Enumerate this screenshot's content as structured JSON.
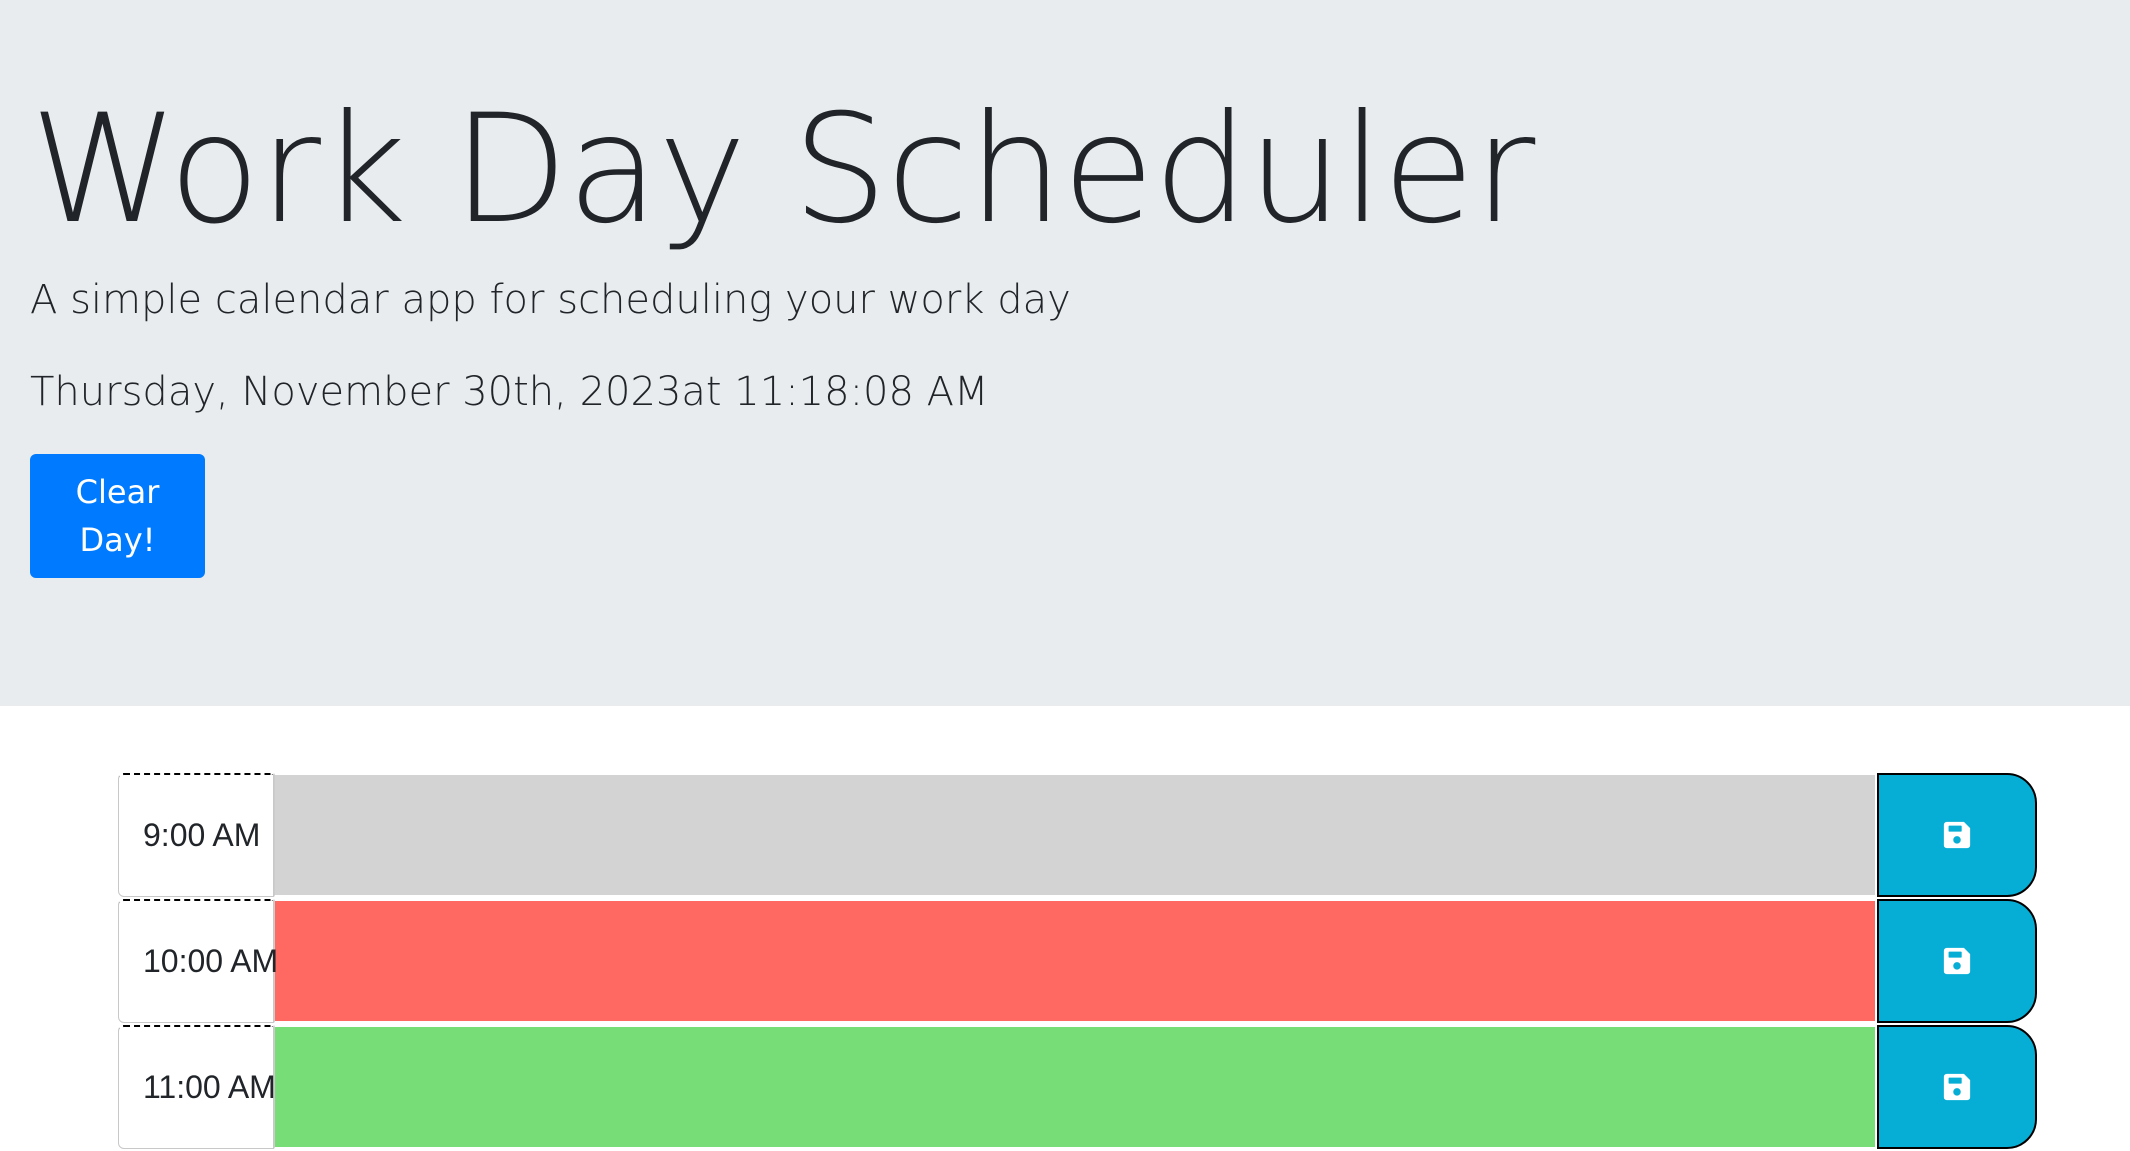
{
  "header": {
    "title": "Work Day Scheduler",
    "subtitle": "A simple calendar app for scheduling your work day",
    "current_datetime": "Thursday, November 30th, 2023at 11:18:08 AM",
    "clear_button_label": "Clear Day!"
  },
  "colors": {
    "past": "#d3d3d3",
    "present": "#ff6961",
    "future": "#77dd77",
    "save_button": "#06aed5",
    "clear_button": "#007bff",
    "jumbotron_bg": "#e9ecef"
  },
  "time_blocks": [
    {
      "hour": "9:00 AM",
      "status": "past",
      "text": "",
      "save_icon": "floppy-disk-icon"
    },
    {
      "hour": "10:00 AM",
      "status": "present",
      "text": "",
      "save_icon": "floppy-disk-icon"
    },
    {
      "hour": "11:00 AM",
      "status": "future",
      "text": "",
      "save_icon": "floppy-disk-icon"
    }
  ]
}
